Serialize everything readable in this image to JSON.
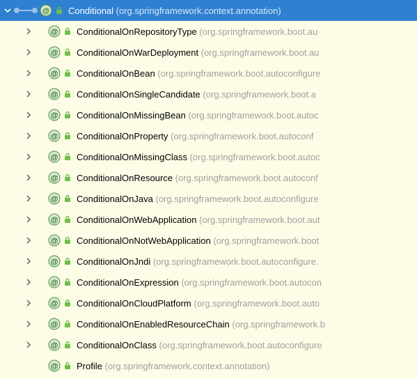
{
  "root": {
    "name": "Conditional",
    "pkg": "(org.springframework.context.annotation)"
  },
  "children": [
    {
      "name": "ConditionalOnRepositoryType",
      "pkg": "(org.springframework.boot.au",
      "expandable": true
    },
    {
      "name": "ConditionalOnWarDeployment",
      "pkg": "(org.springframework.boot.au",
      "expandable": true
    },
    {
      "name": "ConditionalOnBean",
      "pkg": "(org.springframework.boot.autoconfigure",
      "expandable": true
    },
    {
      "name": "ConditionalOnSingleCandidate",
      "pkg": "(org.springframework.boot.a",
      "expandable": true
    },
    {
      "name": "ConditionalOnMissingBean",
      "pkg": "(org.springframework.boot.autoc",
      "expandable": true
    },
    {
      "name": "ConditionalOnProperty",
      "pkg": "(org.springframework.boot.autoconf",
      "expandable": true
    },
    {
      "name": "ConditionalOnMissingClass",
      "pkg": "(org.springframework.boot.autoc",
      "expandable": true
    },
    {
      "name": "ConditionalOnResource",
      "pkg": "(org.springframework.boot.autoconf",
      "expandable": true
    },
    {
      "name": "ConditionalOnJava",
      "pkg": "(org.springframework.boot.autoconfigure",
      "expandable": true
    },
    {
      "name": "ConditionalOnWebApplication",
      "pkg": "(org.springframework.boot.aut",
      "expandable": true
    },
    {
      "name": "ConditionalOnNotWebApplication",
      "pkg": "(org.springframework.boot",
      "expandable": true
    },
    {
      "name": "ConditionalOnJndi",
      "pkg": "(org.springframework.boot.autoconfigure.",
      "expandable": true
    },
    {
      "name": "ConditionalOnExpression",
      "pkg": "(org.springframework.boot.autocon",
      "expandable": true
    },
    {
      "name": "ConditionalOnCloudPlatform",
      "pkg": "(org.springframework.boot.auto",
      "expandable": true
    },
    {
      "name": "ConditionalOnEnabledResourceChain",
      "pkg": "(org.springframework.b",
      "expandable": true
    },
    {
      "name": "ConditionalOnClass",
      "pkg": "(org.springframework.boot.autoconfigure",
      "expandable": true
    },
    {
      "name": "Profile",
      "pkg": "(org.springframework.context.annotation)",
      "expandable": false
    }
  ]
}
